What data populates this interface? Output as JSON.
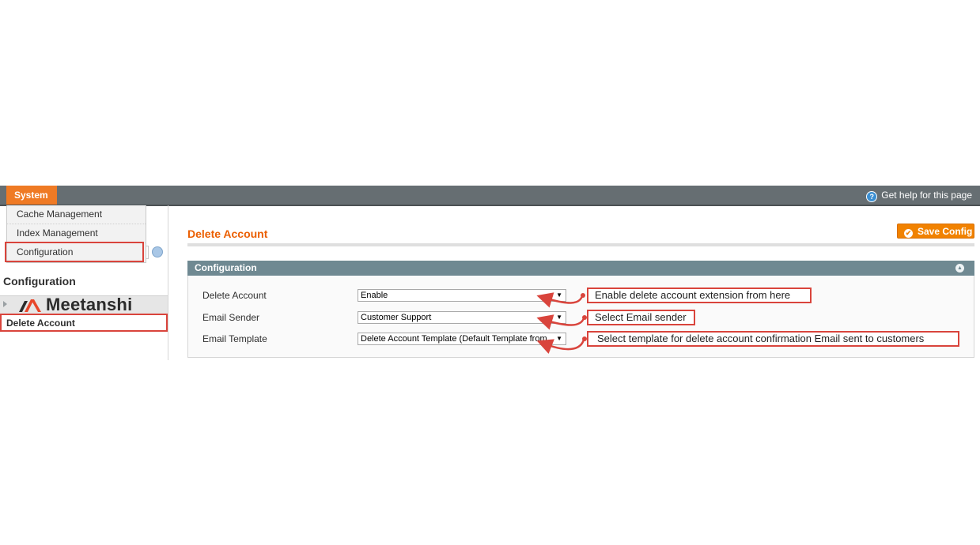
{
  "topnav": {
    "active_menu": "System",
    "help_text": "Get help for this page"
  },
  "system_menu": {
    "items": [
      "Cache Management",
      "Index Management",
      "Configuration"
    ]
  },
  "sidebar": {
    "title": "Configuration",
    "brand": "Meetanshi",
    "items": [
      "Delete Account"
    ]
  },
  "page": {
    "title": "Delete Account",
    "save_label": "Save Config"
  },
  "section": {
    "title": "Configuration",
    "fields": [
      {
        "label": "Delete Account",
        "value": "Enable"
      },
      {
        "label": "Email Sender",
        "value": "Customer Support"
      },
      {
        "label": "Email Template",
        "value": "Delete Account Template (Default Template from"
      }
    ]
  },
  "annotations": [
    "Enable delete account extension from here",
    "Select Email sender",
    "Select template for delete account confirmation Email sent to customers"
  ],
  "colors": {
    "accent": "#ef7a24",
    "title": "#eb5e00",
    "section_header": "#6f8992",
    "annotation_red": "#d9443c"
  },
  "icons": [
    "help-icon",
    "check-icon",
    "collapse-icon",
    "dropdown-caret-icon",
    "chevron-right-icon",
    "meetanshi-logo"
  ]
}
